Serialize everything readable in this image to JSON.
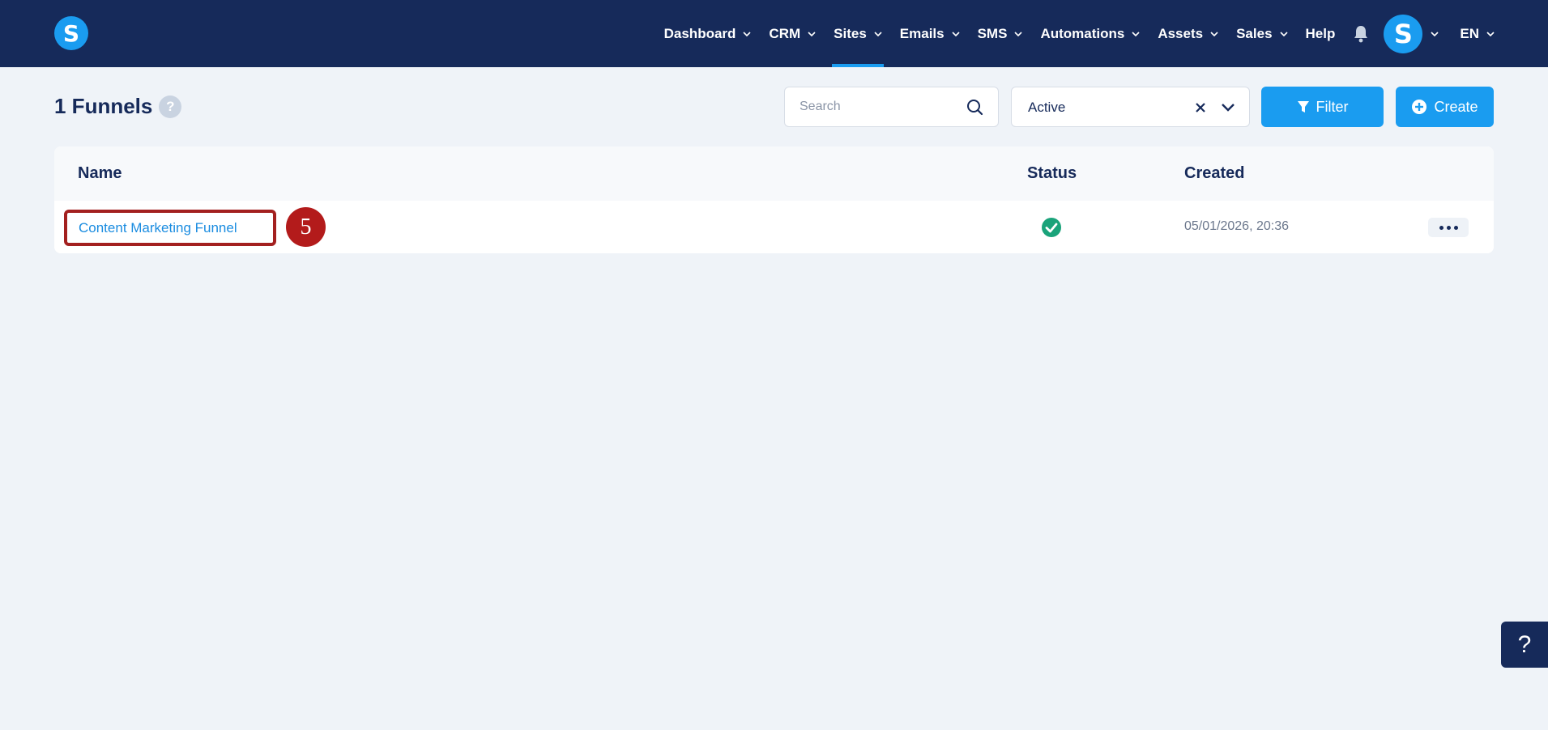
{
  "brand": {
    "logo_letter": "S"
  },
  "nav": {
    "items": [
      {
        "label": "Dashboard",
        "dropdown": true,
        "active": false
      },
      {
        "label": "CRM",
        "dropdown": true,
        "active": false
      },
      {
        "label": "Sites",
        "dropdown": true,
        "active": true
      },
      {
        "label": "Emails",
        "dropdown": true,
        "active": false
      },
      {
        "label": "SMS",
        "dropdown": true,
        "active": false
      },
      {
        "label": "Automations",
        "dropdown": true,
        "active": false
      },
      {
        "label": "Assets",
        "dropdown": true,
        "active": false
      },
      {
        "label": "Sales",
        "dropdown": true,
        "active": false
      },
      {
        "label": "Help",
        "dropdown": false,
        "active": false
      }
    ],
    "avatar_letter": "S",
    "language": "EN"
  },
  "header": {
    "title": "1 Funnels",
    "help_label": "?"
  },
  "search": {
    "placeholder": "Search",
    "value": ""
  },
  "status_filter": {
    "value": "Active"
  },
  "buttons": {
    "filter_label": "Filter",
    "create_label": "Create"
  },
  "table": {
    "columns": {
      "name": "Name",
      "status": "Status",
      "created": "Created"
    },
    "rows": [
      {
        "name": "Content Marketing Funnel",
        "status": "active",
        "created": "05/01/2026, 20:36"
      }
    ]
  },
  "annotation": {
    "step_number": "5"
  },
  "support": {
    "label": "?"
  },
  "colors": {
    "nav_bg": "#162a5a",
    "accent": "#1a9cf0",
    "page_bg": "#eff3f8",
    "status_ok": "#1aa37a",
    "highlight": "#a3201f"
  }
}
